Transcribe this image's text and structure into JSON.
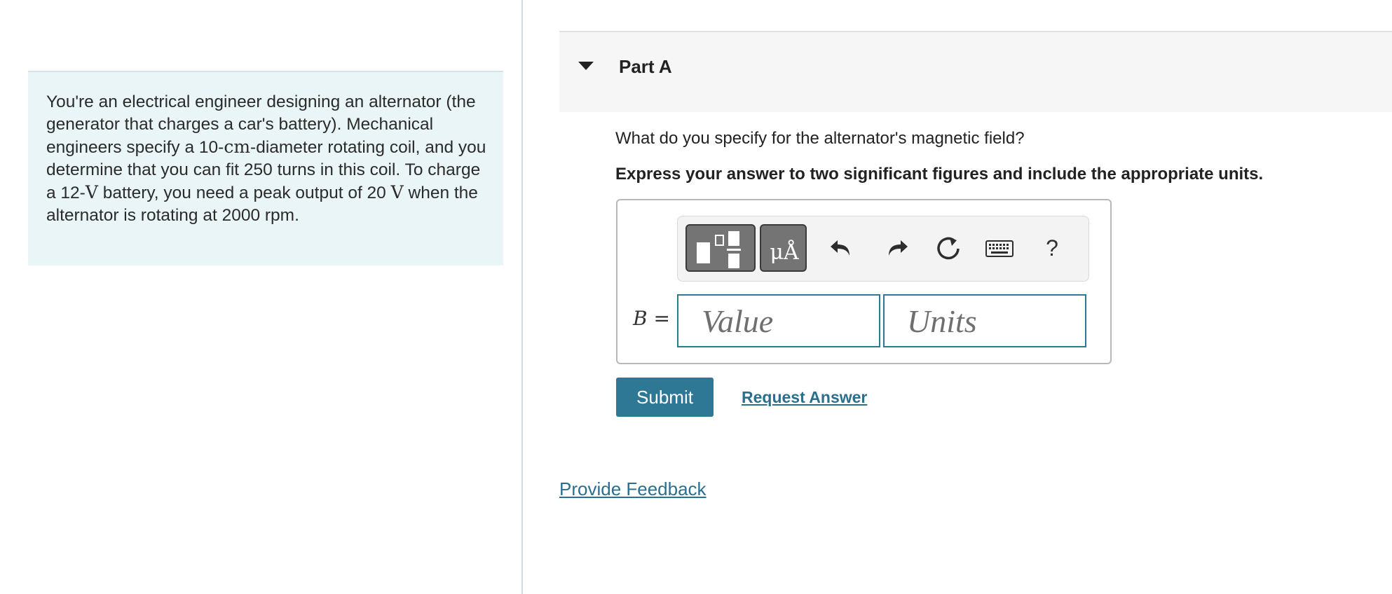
{
  "problem": {
    "text_parts": [
      "You're an electrical engineer designing an alternator (the generator that charges a car's battery). Mechanical engineers specify a 10-",
      "cm",
      "-diameter rotating coil, and you determine that you can fit 250 turns in this coil. To charge a 12-",
      "V",
      " battery, you need a peak output of 20 ",
      "V",
      " when the alternator is rotating at 2000 rpm."
    ]
  },
  "part": {
    "title": "Part A",
    "question": "What do you specify for the alternator's magnetic field?",
    "instruction": "Express your answer to two significant figures and include the appropriate units."
  },
  "toolbar": {
    "units_button_label": "μÅ",
    "help_label": "?"
  },
  "answer": {
    "variable": "B",
    "equals": " =",
    "value_placeholder": "Value",
    "units_placeholder": "Units",
    "value": "",
    "units": ""
  },
  "actions": {
    "submit_label": "Submit",
    "request_answer_label": "Request Answer",
    "feedback_label": "Provide Feedback"
  },
  "colors": {
    "problem_background": "#e9f5f6",
    "accent": "#2f7895",
    "link": "#2b6f8f"
  }
}
